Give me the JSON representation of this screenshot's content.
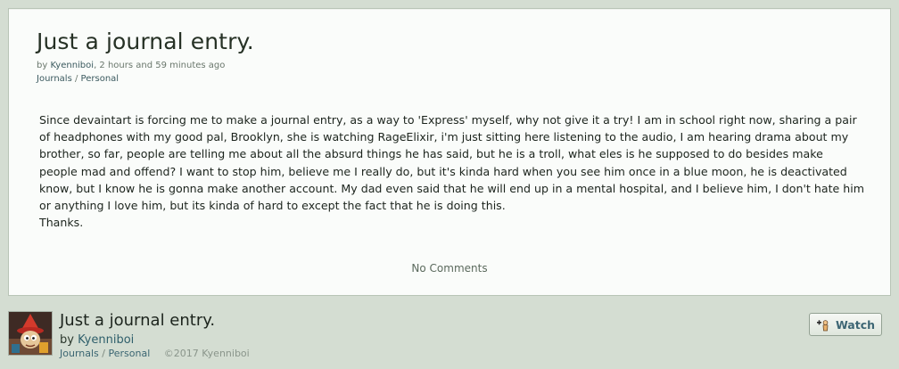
{
  "journal": {
    "title": "Just a journal entry.",
    "by_prefix": "by",
    "author": "Kyenniboi",
    "time_ago": ", 2 hours and 59 minutes ago",
    "crumb_journals": "Journals",
    "crumb_sep": "/",
    "crumb_personal": "Personal",
    "body": "Since devaintart is forcing me to make a journal entry, as a way to 'Express' myself, why not give it a try! I am in school right now, sharing a pair of headphones with my good pal, Brooklyn, she is watching RageElixir, i'm just sitting here listening to the audio, I am hearing drama about my brother, so far, people are telling me about all the absurd things he has said, but he is a troll, what eles is he supposed to do besides make people mad and offend? I want to stop him, believe me I really do, but it's kinda hard when you see him once in a blue moon, he is deactivated know, but I know he is gonna make another account. My dad even said that he will end up in a mental hospital, and I believe him, I don't hate him or anything I love him, but its kinda of hard to except the fact that he is doing this.",
    "signoff": "Thanks.",
    "comments_label": "No Comments"
  },
  "footer": {
    "title": "Just a journal entry.",
    "by_prefix": "by",
    "author": "Kyenniboi",
    "crumb_journals": "Journals",
    "crumb_sep": "/",
    "crumb_personal": "Personal",
    "copyright": "©2017 Kyenniboi",
    "watch_label": "Watch",
    "watch_icon": "watch-plus-icon",
    "avatar_icon": "avatar-image"
  },
  "colors": {
    "page_bg": "#d4ddd2",
    "card_bg": "#fafcfa",
    "link": "#3b5a5f",
    "watch_text": "#3d6674"
  }
}
